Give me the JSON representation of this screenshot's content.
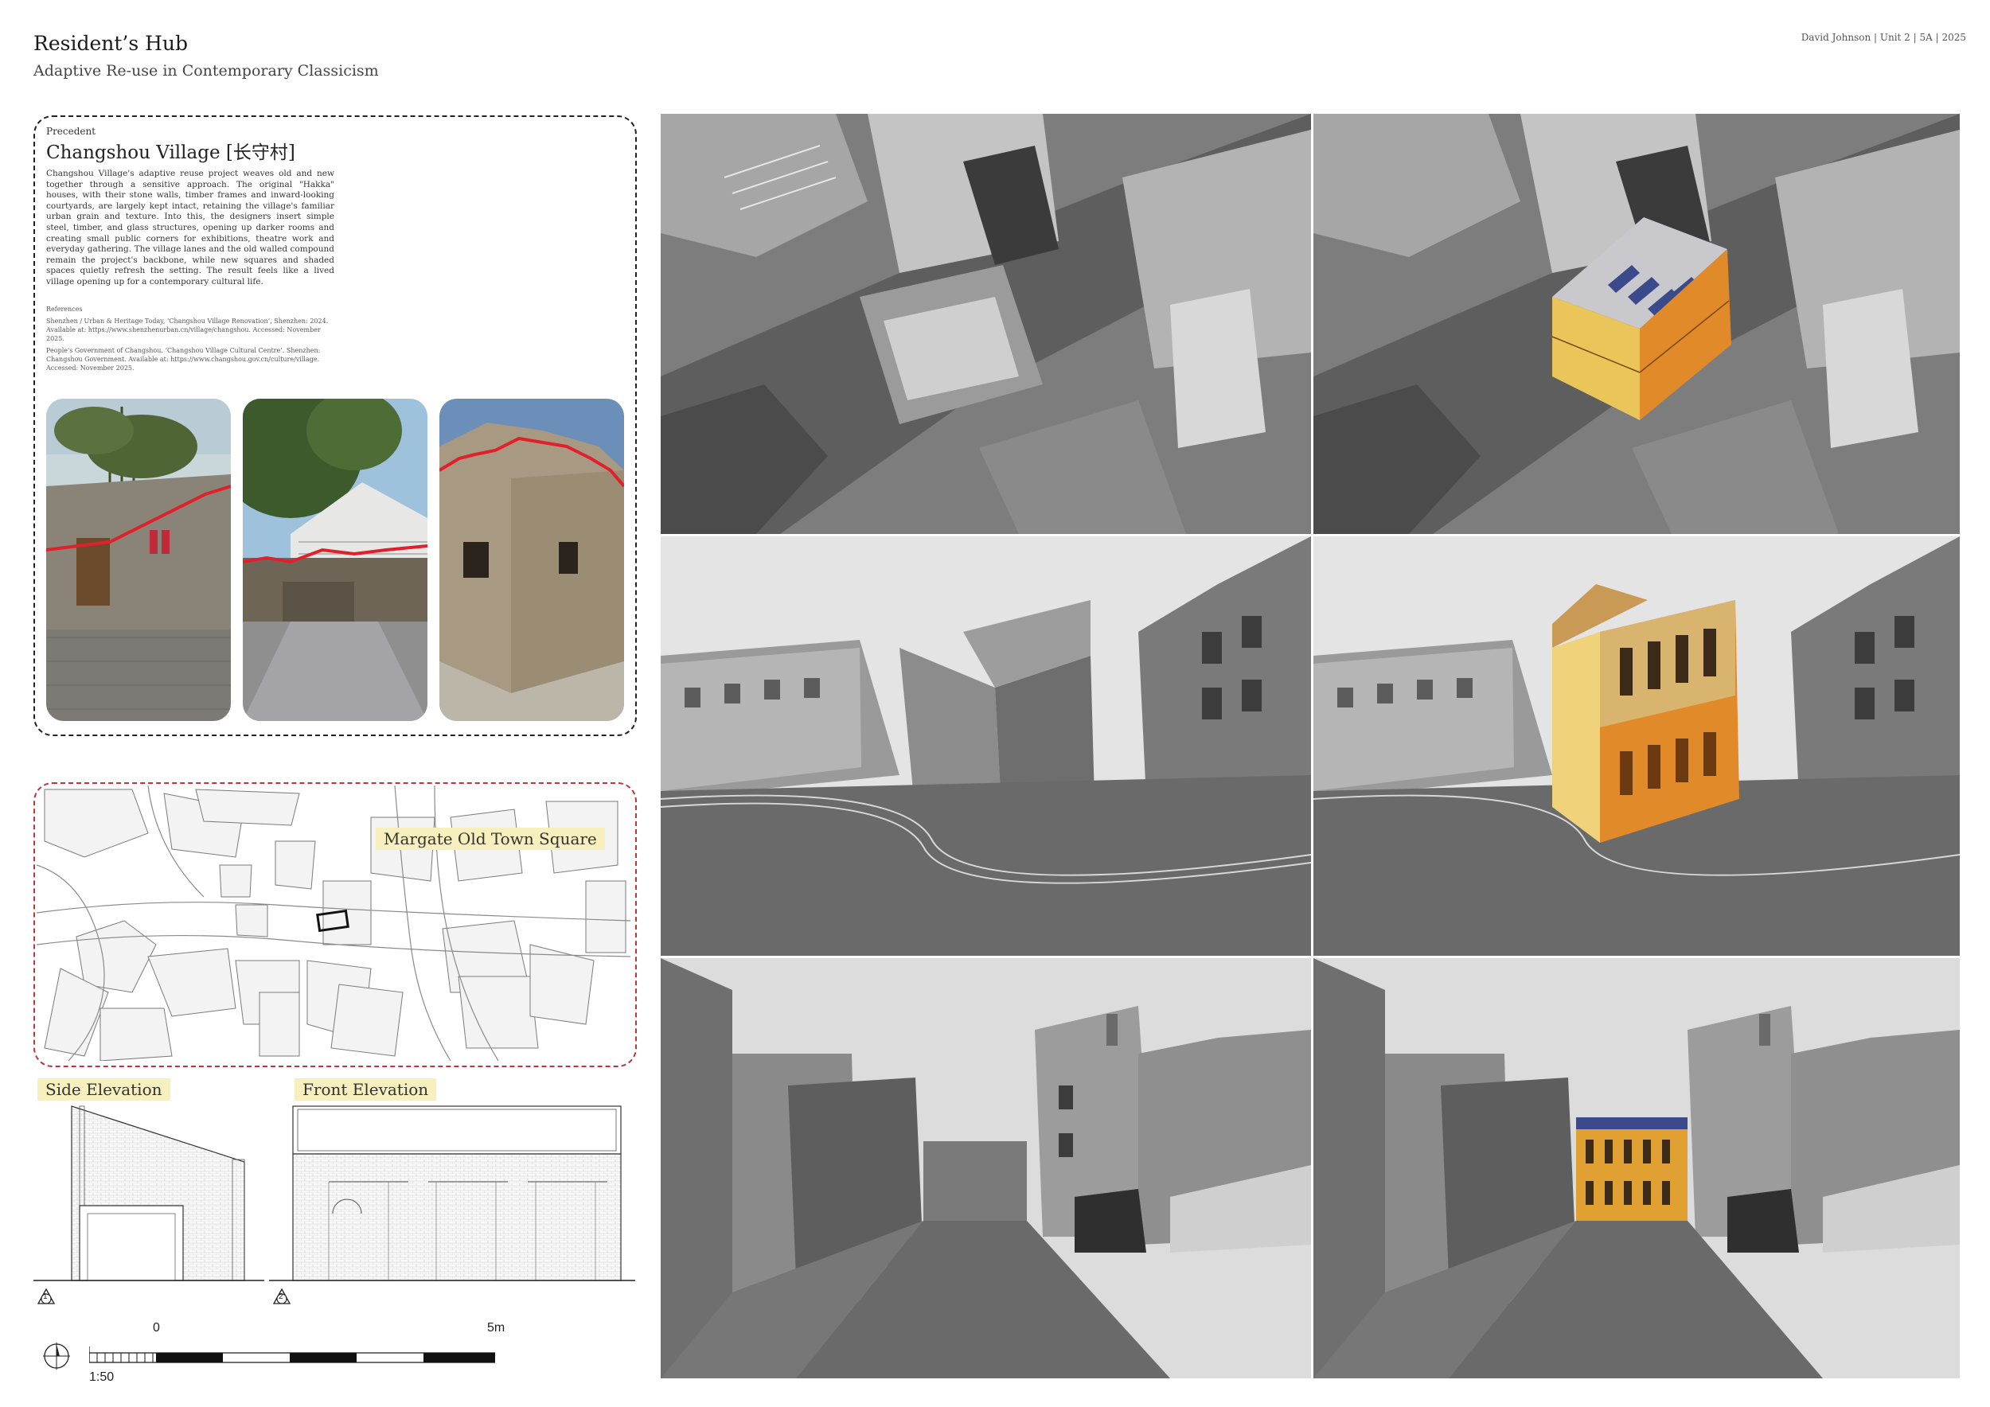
{
  "header": {
    "title": "Resident’s Hub",
    "subtitle": "Adaptive Re-use in Contemporary Classicism",
    "meta": "David Johnson  |  Unit 2  |  5A  |  2025"
  },
  "precedent": {
    "label": "Precedent",
    "name": "Changshou Village [长守村]",
    "body": "Changshou Village's adaptive reuse project weaves old and new together through a sensitive approach. The original \"Hakka\" houses, with their stone walls, timber frames and inward-looking courtyards, are largely kept intact, retaining the village's familiar urban grain and texture. Into this, the designers insert simple steel, timber, and glass structures, opening up darker rooms and creating small public corners for exhibitions, theatre work and everyday gathering. The village lanes and the old walled compound remain the project's backbone, while new squares and shaded spaces quietly refresh the setting. The result feels like a lived village opening up for a contemporary cultural life.",
    "refs_heading": "References",
    "ref1": "Shenzhen / Urban & Heritage Today, ‘Changshou Village Renovation’, Shenzhen: 2024. Available at: https://www.shenzhenurban.cn/village/changshou. Accessed: November 2025.",
    "ref2": "People's Government of Changshou. ‘Changshou Village Cultural Centre’. Shenzhen: Changshou Government. Available at: https://www.changshou.gov.cn/culture/village. Accessed: November 2025."
  },
  "map": {
    "label": "Margate Old Town Square"
  },
  "elevations": {
    "side_label": "Side Elevation",
    "front_label": "Front Elevation",
    "side_num": "1",
    "front_num": "2"
  },
  "scale_bar": {
    "zero": "0",
    "max": "5m",
    "ratio": "1:50"
  },
  "colors": {
    "accent_red": "#c0353c",
    "highlight": "#f7efbd",
    "facade_orange": "#e08a2a",
    "facade_yellow": "#e9c55a"
  }
}
